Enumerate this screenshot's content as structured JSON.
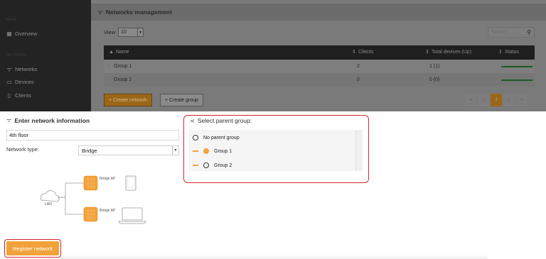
{
  "sidebar": {
    "section_main": "MAIN",
    "overview": "Overview",
    "section_network": "NETWORK",
    "items": [
      {
        "label": "Networks",
        "icon": "wifi-icon"
      },
      {
        "label": "Devices",
        "icon": "devices-icon"
      },
      {
        "label": "Clients",
        "icon": "phone-icon"
      }
    ]
  },
  "management": {
    "title": "Networks management",
    "view_label": "View",
    "view_value": "10",
    "search_placeholder": "Search",
    "columns": [
      "Name",
      "Clients",
      "Total devices (Up)",
      "Status"
    ],
    "rows": [
      {
        "name": "Group 1",
        "clients": "2",
        "devices": "1 (1)"
      },
      {
        "name": "Group 2",
        "clients": "0",
        "devices": "0 (0)"
      }
    ],
    "create_network": "+ Create network",
    "create_group": "+ Create group",
    "pager": [
      "«",
      "‹",
      "1",
      "›",
      "»"
    ]
  },
  "form": {
    "title": "Enter network information",
    "name_value": "4th floor",
    "type_label": "Network type:",
    "type_value": "Bridge",
    "diagram": {
      "cloud_label": "LAN",
      "ap1_label": "Bridge AP",
      "ap2_label": "Bridge AP"
    },
    "register": "Register network"
  },
  "parent_group": {
    "title": "Select parent group:",
    "options": [
      {
        "label": "No parent group",
        "selected": false
      },
      {
        "label": "Group 1",
        "selected": true
      },
      {
        "label": "Group 2",
        "selected": false
      }
    ]
  },
  "colors": {
    "accent": "#f2a23a",
    "highlight_outline": "#d9262b",
    "status_ok": "#1d5a24"
  }
}
